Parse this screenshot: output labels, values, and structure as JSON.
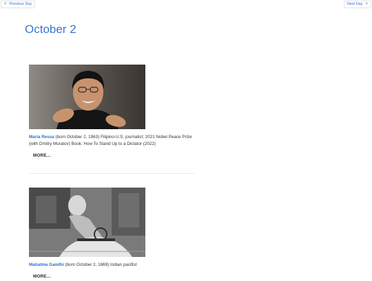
{
  "nav": {
    "prev_label": "Previous Day",
    "prev_arrow": "<",
    "next_label": "Next Day",
    "next_arrow": ">"
  },
  "page": {
    "title": "October 2"
  },
  "entries": [
    {
      "name": "Maria Ressa",
      "text": " (born October 2, 1963) Filipino-U.S. journalist; 2021 Nobel Peace Prize (with Dmitry Muratov) Book: How To Stand Up to a Dictator (2022)",
      "more": "MORE..."
    },
    {
      "name": "Mahatma Gandhi",
      "text": " (born October 2, 1869) Indian pacifist",
      "more": "MORE..."
    }
  ],
  "colors": {
    "link": "#2b6fd6",
    "title": "#3a78c9"
  }
}
